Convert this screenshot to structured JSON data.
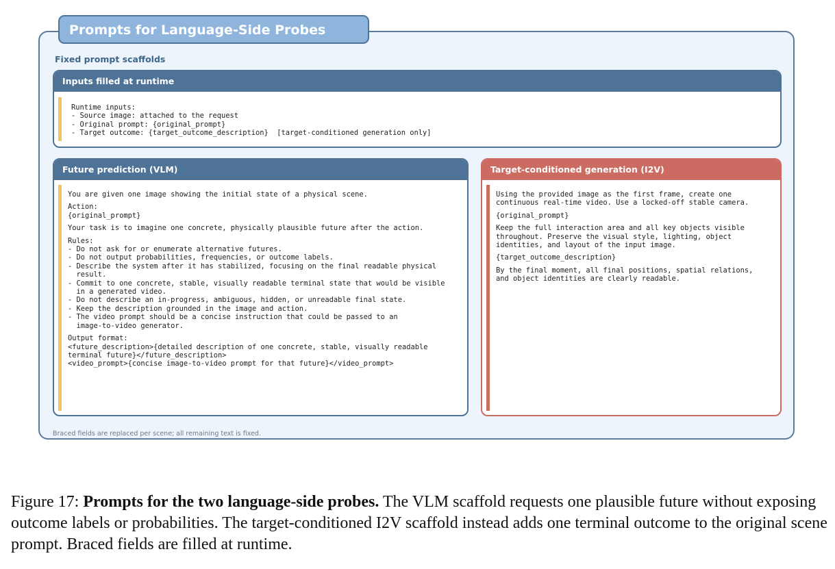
{
  "panel": {
    "title": "Prompts for Language-Side Probes",
    "subheading": "Fixed prompt scaffolds",
    "footnote": "Braced fields are replaced per scene; all remaining text is fixed."
  },
  "runtime_box": {
    "header": "Inputs filled at runtime",
    "lines": [
      "Runtime inputs:",
      "- Source image: attached to the request",
      "- Original prompt: {original_prompt}",
      "- Target outcome: {target_outcome_description}  [target-conditioned generation only]"
    ]
  },
  "vlm_box": {
    "header": "Future prediction (VLM)",
    "lines": [
      "You are given one image showing the initial state of a physical scene.",
      "",
      "Action:",
      "{original_prompt}",
      "",
      "Your task is to imagine one concrete, physically plausible future after the action.",
      "",
      "Rules:",
      "- Do not ask for or enumerate alternative futures.",
      "- Do not output probabilities, frequencies, or outcome labels.",
      "- Describe the system after it has stabilized, focusing on the final readable physical",
      "  result.",
      "- Commit to one concrete, stable, visually readable terminal state that would be visible",
      "  in a generated video.",
      "- Do not describe an in-progress, ambiguous, hidden, or unreadable final state.",
      "- Keep the description grounded in the image and action.",
      "- The video prompt should be a concise instruction that could be passed to an",
      "  image-to-video generator.",
      "",
      "Output format:",
      "<future_description>{detailed description of one concrete, stable, visually readable",
      "terminal future}</future_description>",
      "<video_prompt>{concise image-to-video prompt for that future}</video_prompt>"
    ]
  },
  "i2v_box": {
    "header": "Target-conditioned generation (I2V)",
    "lines": [
      "Using the provided image as the first frame, create one",
      "continuous real-time video. Use a locked-off stable camera.",
      "",
      "{original_prompt}",
      "",
      "Keep the full interaction area and all key objects visible",
      "throughout. Preserve the visual style, lighting, object",
      "identities, and layout of the input image.",
      "",
      "{target_outcome_description}",
      "",
      "By the final moment, all final positions, spatial relations,",
      "and object identities are clearly readable."
    ]
  },
  "caption": {
    "label": "Figure 17: ",
    "bold": "Prompts for the two language-side probes.",
    "text": " The VLM scaffold requests one plausible future without exposing outcome labels or probabilities. The target-conditioned I2V scaffold instead adds one terminal outcome to the original scene prompt. Braced fields are filled at runtime."
  },
  "colors": {
    "blue_header": "#4e7396",
    "red_header": "#cc6b62",
    "yellow_bar": "#ecc565",
    "panel_bg": "#eef4fb"
  }
}
